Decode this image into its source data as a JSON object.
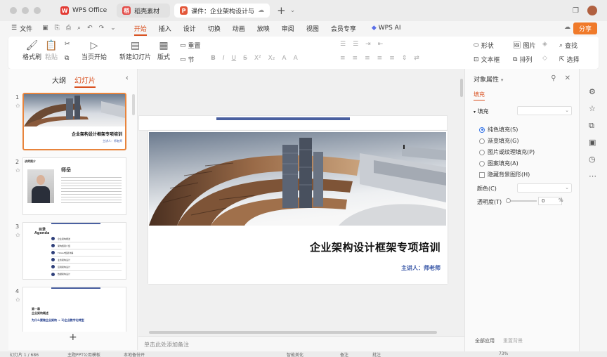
{
  "tabs": [
    {
      "label": "WPS Office",
      "logo": "W",
      "color": "#e33b34"
    },
    {
      "label": "稻壳素材",
      "logo": "稻",
      "color": "#e34a46"
    },
    {
      "label": "课件：企业架构设计与实标",
      "logo": "P",
      "color": "#e3573a"
    }
  ],
  "menu": {
    "file": "文件",
    "items": [
      "开始",
      "插入",
      "设计",
      "切换",
      "动画",
      "放映",
      "审阅",
      "视图",
      "会员专享"
    ],
    "active": "开始",
    "ai": "WPS AI",
    "share": "分享"
  },
  "ribbon": {
    "format_painter": "格式刷",
    "paste": "粘贴",
    "from_current": "当页开始",
    "new_slide": "新建幻灯片",
    "layout": "版式",
    "reset": "重置",
    "section": "节",
    "shape": "形状",
    "image": "图片",
    "find": "查找",
    "textbox": "文本框",
    "arrange": "排列",
    "select": "选择"
  },
  "left_panel": {
    "tab_outline": "大纲",
    "tab_slides": "幻灯片",
    "slides": [
      {
        "num": "1",
        "title": "企业架构设计框架专项培训",
        "presenter": "主讲人：师老师"
      },
      {
        "num": "2",
        "heading": "师岳",
        "label": "讲师简介"
      },
      {
        "num": "3",
        "title": "目录",
        "subtitle": "Agenda",
        "items": [
          "企业架构概述",
          "架构框架介绍",
          "TOGAF框架详解",
          "业务架构设计",
          "应用架构设计",
          "数据架构设计"
        ]
      },
      {
        "num": "4",
        "line1": "第一章",
        "line2": "企业架构概述",
        "line3": "为什么要做企业架构 → 1)企业数字化转型"
      }
    ]
  },
  "slide": {
    "title": "企业架构设计框架专项培训",
    "presenter": "主讲人：师老师"
  },
  "notes_placeholder": "单击此处添加备注",
  "right_panel": {
    "header": "对象属性",
    "tab": "填充",
    "fill_label": "填充",
    "options": [
      "纯色填充(S)",
      "渐变填充(G)",
      "图片或纹理填充(P)",
      "图案填充(A)"
    ],
    "selected_option": "纯色填充(S)",
    "checkbox": "隐藏背景图形(H)",
    "color_label": "颜色(C)",
    "transparency_label": "透明度(T)",
    "transparency_value": "0",
    "transparency_unit": "%",
    "apply_all": "全部应用",
    "reset_bg": "重置背景"
  },
  "status": {
    "slide_count": "幻灯片 1 / 686",
    "theme": "主题PPT公用模板",
    "backup": "本地备份开",
    "beautify": "智能美化",
    "notes": "备注",
    "comments": "批注",
    "zoom": "73%"
  },
  "colors": {
    "accent": "#d9501f",
    "share": "#f07a2a",
    "presenter_blue": "#3a58a8",
    "slide_bar": "#4a60a0"
  }
}
